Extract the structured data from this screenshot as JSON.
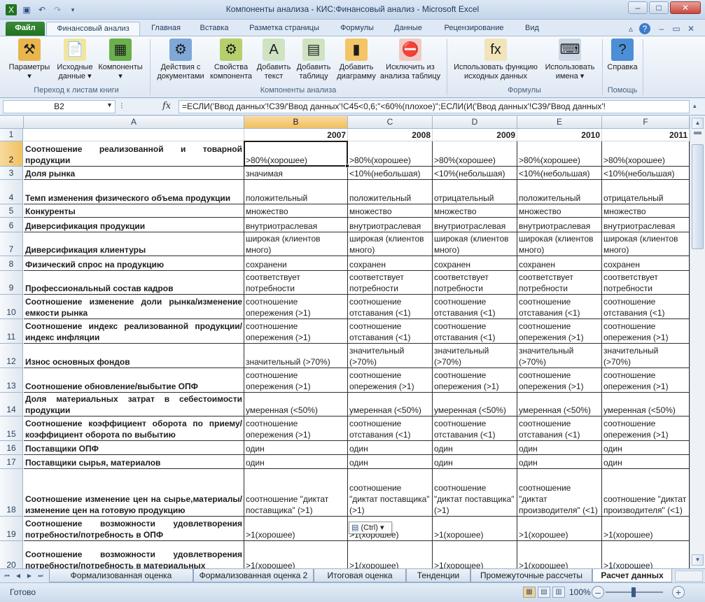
{
  "window": {
    "title": "Компоненты анализа - КИС:Финансовый анализ - Microsoft Excel",
    "controls": {
      "minimize": "–",
      "maximize": "□",
      "close": "✕"
    }
  },
  "quick_access": [
    "save-icon",
    "undo-icon",
    "redo-icon",
    "customize-icon"
  ],
  "ribbon_tabs": [
    {
      "label": "Файл",
      "kind": "file"
    },
    {
      "label": "Финансовый анализ",
      "kind": "active"
    },
    {
      "label": "Главная"
    },
    {
      "label": "Вставка"
    },
    {
      "label": "Разметка страницы"
    },
    {
      "label": "Формулы"
    },
    {
      "label": "Данные"
    },
    {
      "label": "Рецензирование"
    },
    {
      "label": "Вид"
    }
  ],
  "ribbon": {
    "buttons": [
      {
        "name": "parameters-button",
        "icon": "parameters-icon",
        "glyph": "⚒",
        "color": "#e8b64c",
        "lines": [
          "Параметры",
          "▾"
        ]
      },
      {
        "name": "source-data-button",
        "icon": "source-data-icon",
        "glyph": "📄",
        "color": "#f2e5a0",
        "lines": [
          "Исходные",
          "данные ▾"
        ]
      },
      {
        "name": "components-button",
        "icon": "components-icon",
        "glyph": "▦",
        "color": "#6ab04c",
        "lines": [
          "Компоненты",
          "▾"
        ]
      },
      {
        "name": "document-actions-button",
        "icon": "document-actions-icon",
        "glyph": "⚙",
        "color": "#7fa7d8",
        "lines": [
          "Действия с",
          "документами"
        ]
      },
      {
        "name": "component-properties-button",
        "icon": "component-properties-icon",
        "glyph": "⚙",
        "color": "#b5cf6b",
        "lines": [
          "Свойства",
          "компонента"
        ]
      },
      {
        "name": "add-text-button",
        "icon": "add-text-icon",
        "glyph": "A",
        "color": "#cfe3c2",
        "lines": [
          "Добавить",
          "текст"
        ]
      },
      {
        "name": "add-table-button",
        "icon": "add-table-icon",
        "glyph": "▤",
        "color": "#cfe3c2",
        "lines": [
          "Добавить",
          "таблицу"
        ]
      },
      {
        "name": "add-chart-button",
        "icon": "add-chart-icon",
        "glyph": "▮",
        "color": "#f3c565",
        "lines": [
          "Добавить",
          "диаграмму"
        ]
      },
      {
        "name": "exclude-table-button",
        "icon": "exclude-table-icon",
        "glyph": "⛔",
        "color": "#f3c9c4",
        "lines": [
          "Исключить из",
          "анализа таблицу"
        ]
      },
      {
        "name": "use-source-function-button",
        "icon": "function-icon",
        "glyph": "fx",
        "color": "#f1e4b8",
        "lines": [
          "Использовать функцию",
          "исходных данных"
        ]
      },
      {
        "name": "use-names-button",
        "icon": "names-icon",
        "glyph": "⌨",
        "color": "#cdd8e6",
        "lines": [
          "Использовать",
          "имена ▾"
        ]
      },
      {
        "name": "help-button",
        "icon": "help-icon",
        "glyph": "?",
        "color": "#4d8fd6",
        "lines": [
          "Справка",
          ""
        ]
      }
    ],
    "groups": [
      {
        "label": "Переход к листам книги"
      },
      {
        "label": "Компоненты анализа"
      },
      {
        "label": "Формулы"
      },
      {
        "label": "Помощь"
      }
    ]
  },
  "formula_bar": {
    "name_box": "B2",
    "formula": "=ЕСЛИ('Ввод данных'!C39/'Ввод данных'!C45<0,6;\"<60%(плохое)\";ЕСЛИ(И('Ввод данных'!C39/'Ввод данных'!"
  },
  "sheet": {
    "columns": [
      "A",
      "B",
      "C",
      "D",
      "E",
      "F"
    ],
    "selected_column": "B",
    "selected_row": "2",
    "years": [
      "2007",
      "2008",
      "2009",
      "2010",
      "2011"
    ],
    "rows": [
      {
        "n": "2",
        "label": "Соотношение реализованной и товарной продукции",
        "values": [
          ">80%(хорошее)",
          ">80%(хорошее)",
          ">80%(хорошее)",
          ">80%(хорошее)",
          ">80%(хорошее)"
        ]
      },
      {
        "n": "3",
        "label": "Доля рынка",
        "values": [
          "значимая",
          "<10%(небольшая)",
          "<10%(небольшая)",
          "<10%(небольшая)",
          "<10%(небольшая)"
        ]
      },
      {
        "n": "4",
        "label": "Темп изменения физического объема продукции",
        "values": [
          "положительный",
          "положительный",
          "отрицательный",
          "положительный",
          "отрицательный"
        ]
      },
      {
        "n": "5",
        "label": "Конкуренты",
        "values": [
          "множество",
          "множество",
          "множество",
          "множество",
          "множество"
        ]
      },
      {
        "n": "6",
        "label": "Диверсификация продукции",
        "values": [
          "внутриотраслевая",
          "внутриотраслевая",
          "внутриотраслевая",
          "внутриотраслевая",
          "внутриотраслевая"
        ]
      },
      {
        "n": "7",
        "label": "Диверсификация клиентуры",
        "values": [
          "широкая (клиентов много)",
          "широкая (клиентов много)",
          "широкая (клиентов много)",
          "широкая (клиентов много)",
          "широкая (клиентов много)"
        ]
      },
      {
        "n": "8",
        "label": "Физический спрос на продукцию",
        "values": [
          "сохранени",
          "сохранен",
          "сохранен",
          "сохранен",
          "сохранен"
        ]
      },
      {
        "n": "9",
        "label": "Профессиональный состав кадров",
        "values": [
          "соответствует потребности",
          "соответствует потребности",
          "соответствует потребности",
          "соответствует потребности",
          "соответствует потребности"
        ]
      },
      {
        "n": "10",
        "label": "Соотношение изменение доли рынка/изменение емкости рынка",
        "values": [
          "соотношение опережения (>1)",
          "соотношение отставания (<1)",
          "соотношение отставания (<1)",
          "соотношение отставания (<1)",
          "соотношение отставания (<1)"
        ]
      },
      {
        "n": "11",
        "label": "Соотношение индекс реализованной продукции/индекс инфляции",
        "values": [
          "соотношение опережения (>1)",
          "соотношение отставания (<1)",
          "соотношение отставания (<1)",
          "соотношение опережения (>1)",
          "соотношение опережения (>1)"
        ]
      },
      {
        "n": "12",
        "label": "Износ основных фондов",
        "values": [
          "значительный (>70%)",
          "значительный (>70%)",
          "значительный (>70%)",
          "значительный (>70%)",
          "значительный (>70%)"
        ]
      },
      {
        "n": "13",
        "label": "Соотношение обновление/выбытие ОПФ",
        "values": [
          "соотношение опережения (>1)",
          "соотношение опережения (>1)",
          "соотношение опережения (>1)",
          "соотношение опережения (>1)",
          "соотношение опережения (>1)"
        ]
      },
      {
        "n": "14",
        "label": "Доля материальных затрат в себестоимости продукции",
        "values": [
          "умеренная (<50%)",
          "умеренная (<50%)",
          "умеренная (<50%)",
          "умеренная (<50%)",
          "умеренная (<50%)"
        ]
      },
      {
        "n": "15",
        "label": "Соотношение коэффициент оборота по приему/коэффициент оборота по выбытию",
        "values": [
          "соотношение опережения (>1)",
          "соотношение отставания (<1)",
          "соотношение отставания (<1)",
          "соотношение отставания (<1)",
          "соотношение опережения (>1)"
        ]
      },
      {
        "n": "16",
        "label": "Поставщики ОПФ",
        "values": [
          "один",
          "один",
          "один",
          "один",
          "один"
        ]
      },
      {
        "n": "17",
        "label": "Поставщики сырья, материалов",
        "values": [
          "один",
          "один",
          "один",
          "один",
          "один"
        ]
      },
      {
        "n": "18",
        "label": "Соотношение изменение цен на сырье,материалы/изменение цен на готовую продукцию",
        "values": [
          "соотношение \"диктат поставщика\" (>1)",
          "соотношение \"диктат поставщика\" (>1)",
          "соотношение \"диктат поставщика\" (>1)",
          "соотношение \"диктат производителя\" (<1)",
          "соотношение \"диктат производителя\" (<1)"
        ]
      },
      {
        "n": "19",
        "label": "Соотношение возможности удовлетворения потребности/потребность в ОПФ",
        "values": [
          ">1(хорошее)",
          ">1(хорошее)",
          ">1(хорошее)",
          ">1(хорошее)",
          ">1(хорошее)"
        ]
      },
      {
        "n": "20",
        "label": "Соотношение возможности удовлетворения потребности/потребность в материальных",
        "values": [
          ">1(хорошее)",
          ">1(хорошее)",
          ">1(хорошее)",
          ">1(хорошее)",
          ">1(хорошее)"
        ]
      }
    ],
    "paste_options_label": "(Ctrl) ▾"
  },
  "sheet_tabs": [
    "Формализованная оценка",
    "Формализованная оценка 2",
    "Итоговая оценка",
    "Тенденции",
    "Промежуточные рассчеты",
    "Расчет данных"
  ],
  "active_sheet": "Расчет данных",
  "status": {
    "ready": "Готово",
    "zoom": "100%"
  }
}
